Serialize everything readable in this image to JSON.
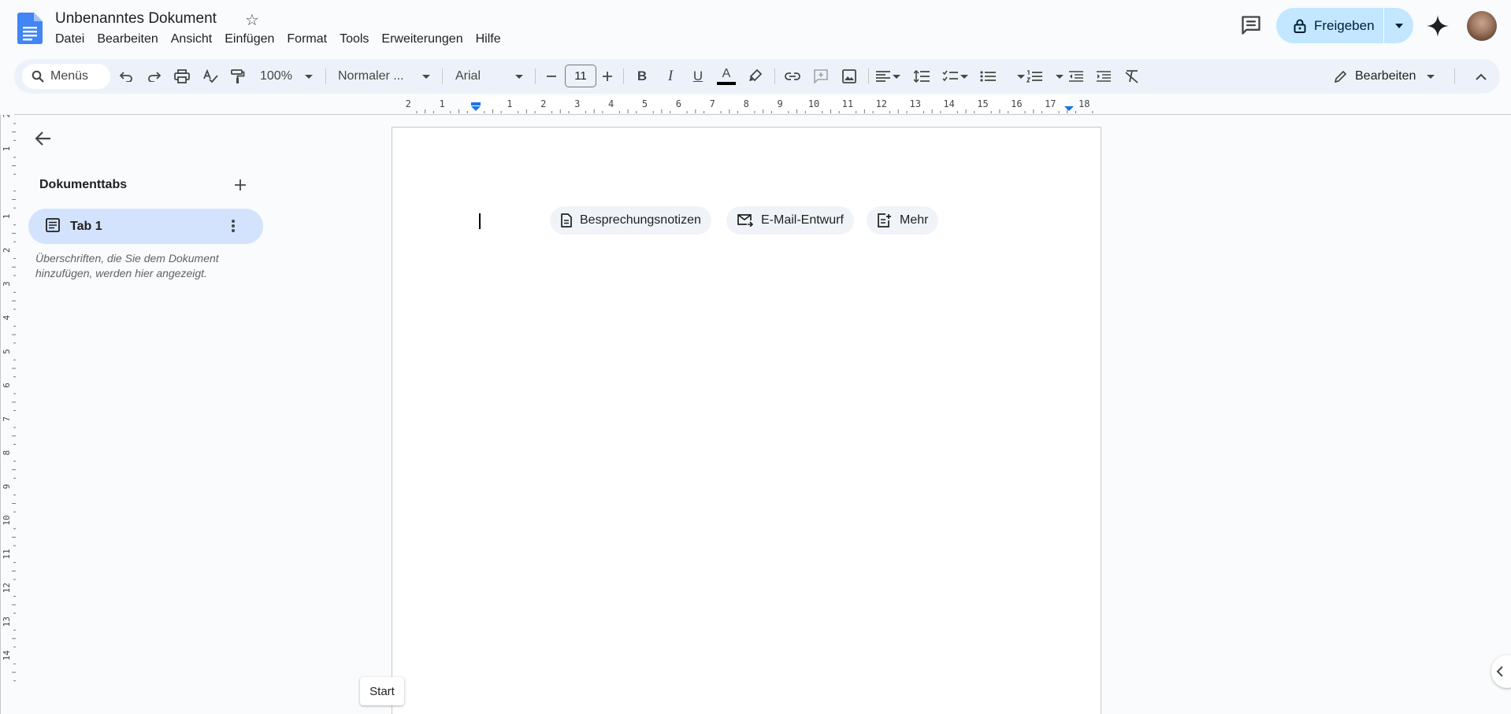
{
  "document": {
    "title": "Unbenanntes Dokument"
  },
  "menu": [
    "Datei",
    "Bearbeiten",
    "Ansicht",
    "Einfügen",
    "Format",
    "Tools",
    "Erweiterungen",
    "Hilfe"
  ],
  "header": {
    "share_label": "Freigeben"
  },
  "toolbar": {
    "search_label": "Menüs",
    "zoom": "100%",
    "style": "Normaler ...",
    "font": "Arial",
    "font_size": "11",
    "mode_label": "Bearbeiten",
    "text_color": "#000000"
  },
  "ruler": {
    "horizontal_labels": [
      "2",
      "1",
      "",
      "1",
      "2",
      "3",
      "4",
      "5",
      "6",
      "7",
      "8",
      "9",
      "10",
      "11",
      "12",
      "13",
      "14",
      "15",
      "16",
      "17",
      "18"
    ],
    "vertical_labels": [
      "2",
      "1",
      "",
      "1",
      "2",
      "3",
      "4",
      "5",
      "6",
      "7",
      "8",
      "9",
      "10",
      "11",
      "12",
      "13",
      "14"
    ]
  },
  "sidebar": {
    "heading": "Dokumenttabs",
    "tabs": [
      {
        "label": "Tab 1"
      }
    ],
    "hint": "Überschriften, die Sie dem Dokument hinzufügen, werden hier angezeigt."
  },
  "chips": [
    {
      "label": "Besprechungsnotizen",
      "icon": "document-icon"
    },
    {
      "label": "E-Mail-Entwurf",
      "icon": "mail-icon"
    },
    {
      "label": "Mehr",
      "icon": "note-add-icon"
    }
  ],
  "tooltip": {
    "start": "Start"
  },
  "colors": {
    "accent": "#c2e7ff",
    "toolbar_bg": "#edf2fa",
    "tab_selected": "#d3e3fd",
    "docs_blue": "#4285f4"
  }
}
